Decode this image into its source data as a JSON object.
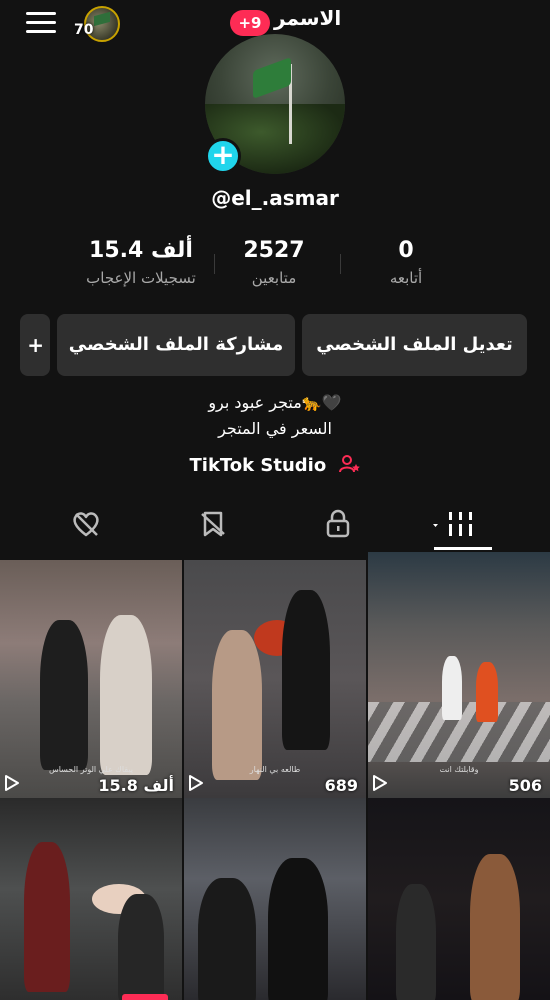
{
  "header": {
    "title": "الاسمر",
    "notification_badge": "+9",
    "mini_avatar_count": "70"
  },
  "profile": {
    "handle": "@el_.asmar",
    "stats": {
      "likes": {
        "value": "15.4 ألف",
        "label": "تسجيلات الإعجاب"
      },
      "followers": {
        "value": "2527",
        "label": "متابعين"
      },
      "following": {
        "value": "0",
        "label": "أتابعه"
      }
    },
    "buttons": {
      "edit": "تعديل الملف الشخصي",
      "share": "مشاركة الملف الشخصي",
      "more": "+"
    },
    "bio": {
      "line1": "متجر عبود برو🐆🖤",
      "line2": "السعر في المتجر"
    },
    "studio_link": "TikTok Studio"
  },
  "tabs": [
    {
      "icon": "videos-grid-icon",
      "active": true
    },
    {
      "icon": "lock-icon",
      "active": false
    },
    {
      "icon": "bookmark-hidden-icon",
      "active": false
    },
    {
      "icon": "liked-hidden-icon",
      "active": false
    }
  ],
  "videos": [
    {
      "views": "15.8 ألف",
      "caption": "يبقاك علي الوتر الحساس"
    },
    {
      "views": "689",
      "caption": "طالعه بي النهار"
    },
    {
      "views": "506",
      "caption": "وقابلتك انت"
    },
    {
      "views": "",
      "caption": ""
    },
    {
      "views": "",
      "caption": ""
    },
    {
      "views": "",
      "caption": ""
    }
  ],
  "colors": {
    "background": "#121212",
    "accent": "#fe2c55",
    "cyan": "#20d5ec",
    "button_bg": "#2f2f2f"
  }
}
